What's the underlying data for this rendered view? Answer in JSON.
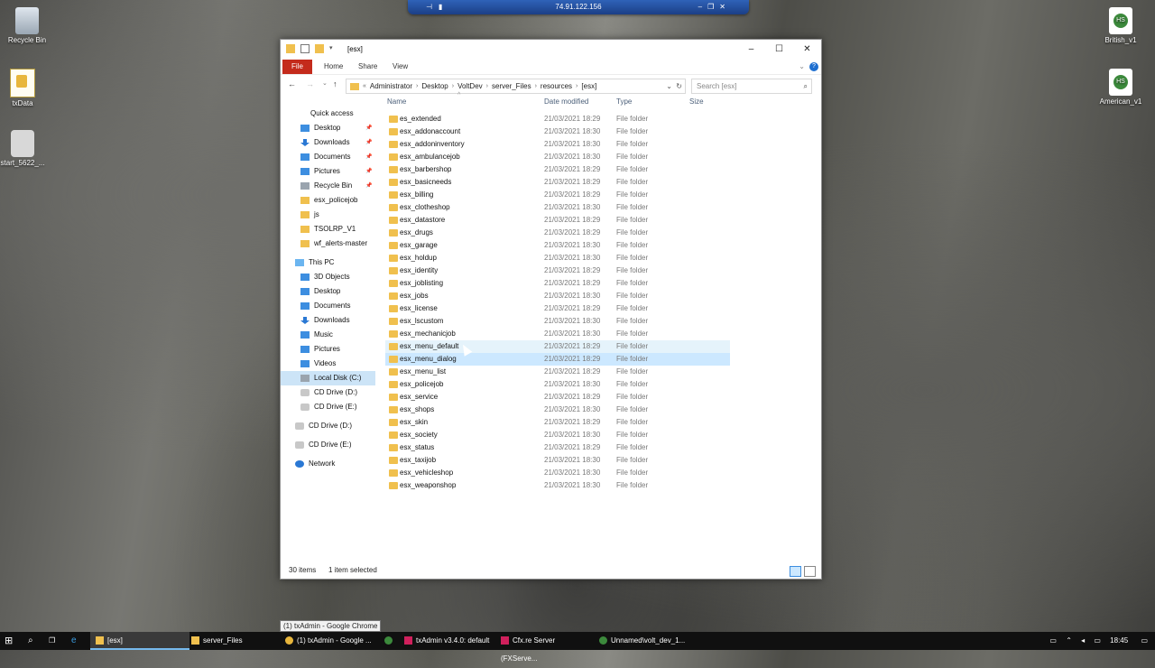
{
  "remote": {
    "title": "74.91.122.156"
  },
  "desktop": {
    "left_icons": [
      {
        "label": "Recycle Bin"
      },
      {
        "label": "txData"
      },
      {
        "label": "start_5622_..."
      }
    ],
    "right_icons": [
      {
        "label": "British_v1"
      },
      {
        "label": "American_v1"
      }
    ]
  },
  "window": {
    "title": "[esx]",
    "ribbon": {
      "file": "File",
      "home": "Home",
      "share": "Share",
      "view": "View"
    },
    "breadcrumb": [
      "Administrator",
      "Desktop",
      "VoltDev",
      "server_Files",
      "resources",
      "[esx]"
    ],
    "search_placeholder": "Search [esx]",
    "columns": {
      "name": "Name",
      "date": "Date modified",
      "type": "Type",
      "size": "Size"
    },
    "nav": {
      "quick_access": "Quick access",
      "qa_items": [
        "Desktop",
        "Downloads",
        "Documents",
        "Pictures",
        "Recycle Bin",
        "esx_policejob",
        "js",
        "TSOLRP_V1",
        "wf_alerts-master"
      ],
      "this_pc": "This PC",
      "pc_items": [
        "3D Objects",
        "Desktop",
        "Documents",
        "Downloads",
        "Music",
        "Pictures",
        "Videos",
        "Local Disk (C:)",
        "CD Drive (D:)",
        "CD Drive (E:)"
      ],
      "drives": [
        "CD Drive (D:)",
        "CD Drive (E:)"
      ],
      "network": "Network"
    },
    "files": [
      {
        "name": "es_extended",
        "date": "21/03/2021 18:29",
        "type": "File folder"
      },
      {
        "name": "esx_addonaccount",
        "date": "21/03/2021 18:30",
        "type": "File folder"
      },
      {
        "name": "esx_addoninventory",
        "date": "21/03/2021 18:30",
        "type": "File folder"
      },
      {
        "name": "esx_ambulancejob",
        "date": "21/03/2021 18:30",
        "type": "File folder"
      },
      {
        "name": "esx_barbershop",
        "date": "21/03/2021 18:29",
        "type": "File folder"
      },
      {
        "name": "esx_basicneeds",
        "date": "21/03/2021 18:29",
        "type": "File folder"
      },
      {
        "name": "esx_billing",
        "date": "21/03/2021 18:29",
        "type": "File folder"
      },
      {
        "name": "esx_clotheshop",
        "date": "21/03/2021 18:30",
        "type": "File folder"
      },
      {
        "name": "esx_datastore",
        "date": "21/03/2021 18:29",
        "type": "File folder"
      },
      {
        "name": "esx_drugs",
        "date": "21/03/2021 18:29",
        "type": "File folder"
      },
      {
        "name": "esx_garage",
        "date": "21/03/2021 18:30",
        "type": "File folder"
      },
      {
        "name": "esx_holdup",
        "date": "21/03/2021 18:30",
        "type": "File folder"
      },
      {
        "name": "esx_identity",
        "date": "21/03/2021 18:29",
        "type": "File folder"
      },
      {
        "name": "esx_joblisting",
        "date": "21/03/2021 18:29",
        "type": "File folder"
      },
      {
        "name": "esx_jobs",
        "date": "21/03/2021 18:30",
        "type": "File folder"
      },
      {
        "name": "esx_license",
        "date": "21/03/2021 18:29",
        "type": "File folder"
      },
      {
        "name": "esx_lscustom",
        "date": "21/03/2021 18:30",
        "type": "File folder"
      },
      {
        "name": "esx_mechanicjob",
        "date": "21/03/2021 18:30",
        "type": "File folder"
      },
      {
        "name": "esx_menu_default",
        "date": "21/03/2021 18:29",
        "type": "File folder"
      },
      {
        "name": "esx_menu_dialog",
        "date": "21/03/2021 18:29",
        "type": "File folder"
      },
      {
        "name": "esx_menu_list",
        "date": "21/03/2021 18:29",
        "type": "File folder"
      },
      {
        "name": "esx_policejob",
        "date": "21/03/2021 18:30",
        "type": "File folder"
      },
      {
        "name": "esx_service",
        "date": "21/03/2021 18:29",
        "type": "File folder"
      },
      {
        "name": "esx_shops",
        "date": "21/03/2021 18:30",
        "type": "File folder"
      },
      {
        "name": "esx_skin",
        "date": "21/03/2021 18:29",
        "type": "File folder"
      },
      {
        "name": "esx_society",
        "date": "21/03/2021 18:30",
        "type": "File folder"
      },
      {
        "name": "esx_status",
        "date": "21/03/2021 18:29",
        "type": "File folder"
      },
      {
        "name": "esx_taxijob",
        "date": "21/03/2021 18:30",
        "type": "File folder"
      },
      {
        "name": "esx_vehicleshop",
        "date": "21/03/2021 18:30",
        "type": "File folder"
      },
      {
        "name": "esx_weaponshop",
        "date": "21/03/2021 18:30",
        "type": "File folder"
      }
    ],
    "status": {
      "count": "30 items",
      "selected": "1 item selected"
    }
  },
  "tooltip": "(1) txAdmin - Google Chrome",
  "taskbar": {
    "items": [
      "[esx]",
      "server_Files",
      "(1) txAdmin - Google ...",
      "txAdmin v3.4.0: default",
      "Cfx.re Server (FXServe...",
      "Unnamed\\volt_dev_1..."
    ],
    "clock": "18:45"
  },
  "colors": {
    "accent": "#0078d7",
    "file_tab": "#c42b1c",
    "folder": "#f0c04e",
    "selection": "#cce8ff"
  }
}
